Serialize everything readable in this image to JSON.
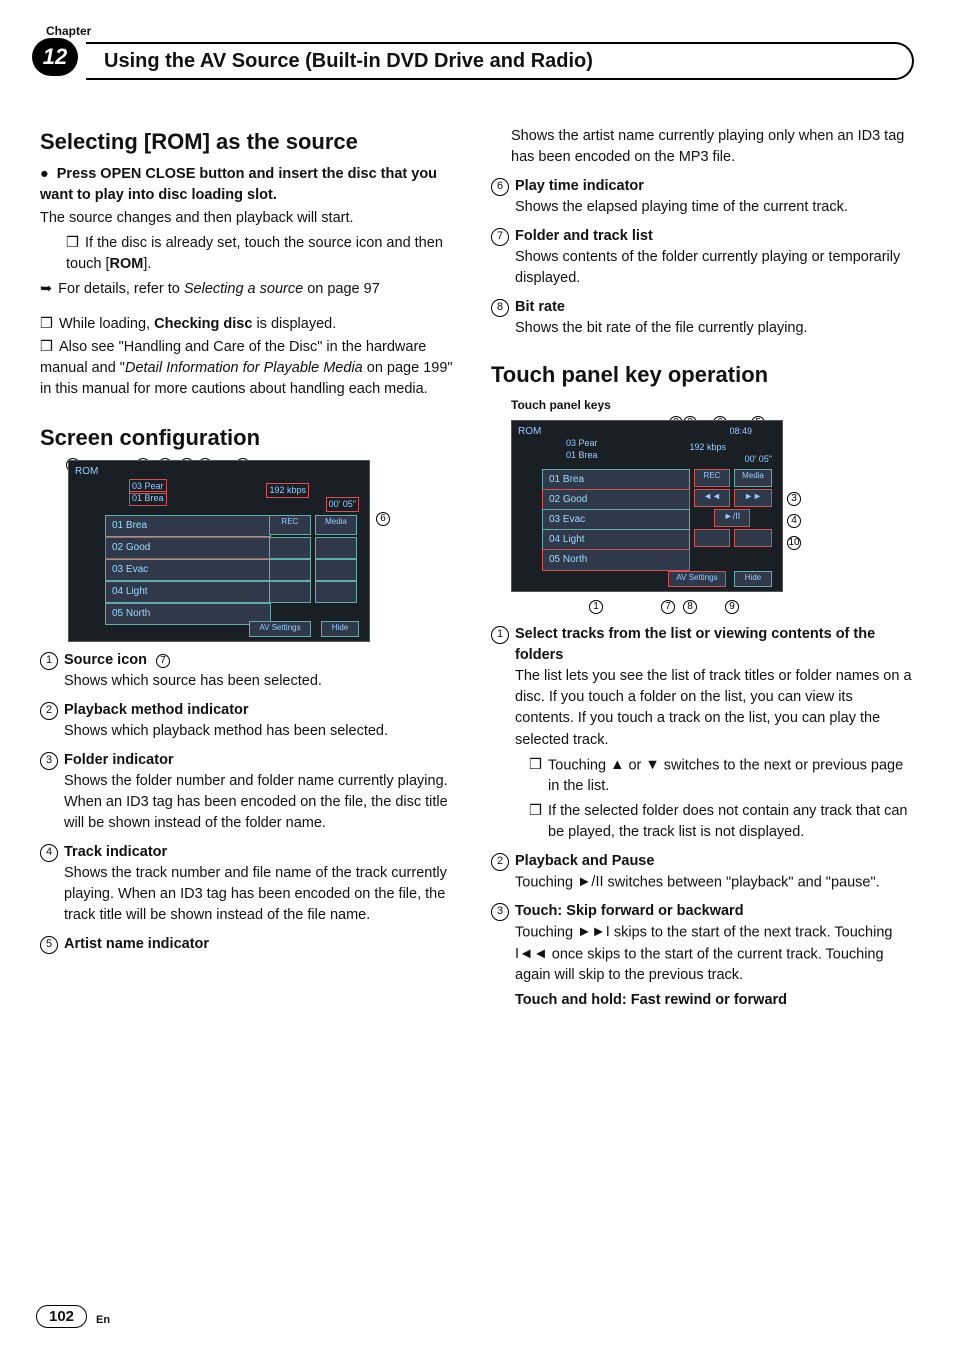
{
  "chapter": {
    "label": "Chapter",
    "number": "12",
    "title": "Using the AV Source (Built-in DVD Drive and Radio)"
  },
  "left": {
    "h_selecting_pre": "Selecting [",
    "h_selecting_rom": "ROM",
    "h_selecting_post": "] as the source",
    "step1": "Press OPEN CLOSE button and insert the disc that you want to play into disc loading slot.",
    "step1_body": "The source changes and then playback will start.",
    "step1_sub_pre": "If the disc is already set, touch the source icon and then touch [",
    "step1_sub_bold": "ROM",
    "step1_sub_post": "].",
    "detail_pre": "For details, refer to ",
    "detail_ital": "Selecting a source",
    "detail_post": " on page 97",
    "note1_pre": "While loading, ",
    "note1_bold": "Checking disc",
    "note1_post": " is displayed.",
    "note2_pre": "Also see \"Handling and Care of the Disc\" in the hardware manual and \"",
    "note2_ital": "Detail Information for Playable Media",
    "note2_post": " on page 199\" in this manual for more cautions about handling each media.",
    "h_screen": "Screen configuration",
    "ss_tracks": [
      "01 Brea",
      "02 Good",
      "03 Evac",
      "04 Light",
      "05 North"
    ],
    "ss_top1": "03 Pear",
    "ss_top2": "01 Brea",
    "ss_rom": "ROM",
    "ss_kbps": "192 kbps",
    "ss_time": "00' 05\"",
    "ss_rec": "REC",
    "ss_media": "Media",
    "ss_av": "AV Settings",
    "ss_hide": "Hide",
    "items": {
      "1": {
        "t": "Source icon",
        "b": "Shows which source has been selected."
      },
      "2": {
        "t": "Playback method indicator",
        "b": "Shows which playback method has been selected."
      },
      "3": {
        "t": "Folder indicator",
        "b": "Shows the folder number and folder name currently playing. When an ID3 tag has been encoded on the file, the disc title will be shown instead of the folder name."
      },
      "4": {
        "t": "Track indicator",
        "b": "Shows the track number and file name of the track currently playing. When an ID3 tag has been encoded on the file, the track title will be shown instead of the file name."
      },
      "5": {
        "t": "Artist name indicator"
      }
    }
  },
  "right": {
    "artist_cont": "Shows the artist name currently playing only when an ID3 tag has been encoded on the MP3 file.",
    "items": {
      "6": {
        "t": "Play time indicator",
        "b": "Shows the elapsed playing time of the current track."
      },
      "7": {
        "t": "Folder and track list",
        "b": "Shows contents of the folder currently playing or temporarily displayed."
      },
      "8": {
        "t": "Bit rate",
        "b": "Shows the bit rate of the file currently playing."
      }
    },
    "h_touch": "Touch panel key operation",
    "touch_label": "Touch panel keys",
    "ss_clock": "08:49",
    "op": {
      "1": {
        "t": "Select tracks from the list or viewing contents of the folders",
        "b": "The list lets you see the list of track titles or folder names on a disc. If you touch a folder on the list, you can view its contents. If you touch a track on the list, you can play the selected track.",
        "s1_pre": "Touching ",
        "s1_post": " switches to the next or previous page in the list.",
        "s2": "If the selected folder does not contain any track that can be played, the track list is not displayed."
      },
      "2": {
        "t": "Playback and Pause",
        "b_pre": "Touching ",
        "b_post": " switches between \"playback\" and \"pause\"."
      },
      "3": {
        "t": "Touch: Skip forward or backward",
        "b_pre": "Touching ",
        "b_mid": " skips to the start of the next track. Touching ",
        "b_post": " once skips to the start of the current track. Touching again will skip to the previous track.",
        "hold": "Touch and hold: Fast rewind or forward"
      }
    }
  },
  "footer": {
    "page": "102",
    "lang": "En"
  }
}
